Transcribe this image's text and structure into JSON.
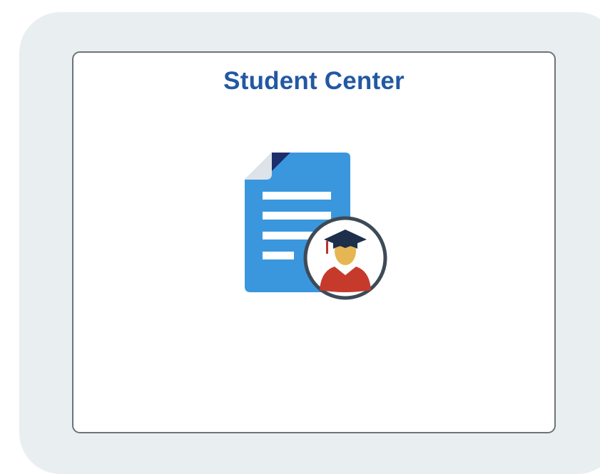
{
  "tile": {
    "title": "Student Center",
    "icon": "student-document-icon"
  },
  "colors": {
    "title": "#2258a3",
    "document": "#3a97dd",
    "badge_ring": "#3d4a57",
    "cap": "#1d2f4a",
    "face": "#e5b652",
    "body": "#c63a2b"
  }
}
